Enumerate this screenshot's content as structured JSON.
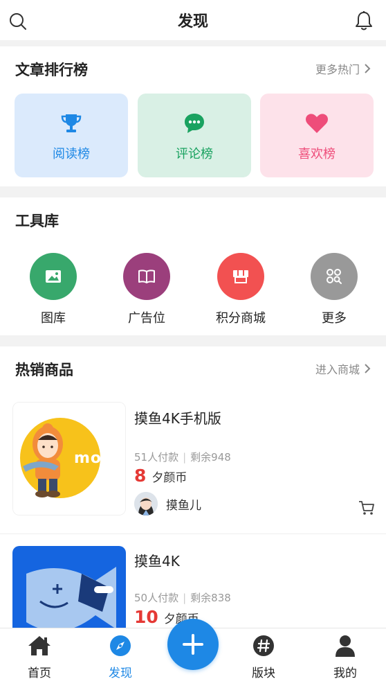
{
  "header": {
    "title": "发现"
  },
  "ranking": {
    "title": "文章排行榜",
    "more_label": "更多热门",
    "tiles": [
      {
        "label": "阅读榜",
        "icon": "trophy-icon",
        "bg": "#dbeafc",
        "color": "#1e88e5"
      },
      {
        "label": "评论榜",
        "icon": "chat-bubble-icon",
        "bg": "#d9f0e5",
        "color": "#1aa260"
      },
      {
        "label": "喜欢榜",
        "icon": "heart-icon",
        "bg": "#fde2ea",
        "color": "#ee4d7a"
      }
    ]
  },
  "tools": {
    "title": "工具库",
    "items": [
      {
        "label": "图库",
        "icon": "image-icon",
        "color": "#38a86c"
      },
      {
        "label": "广告位",
        "icon": "book-icon",
        "color": "#9b3f7c"
      },
      {
        "label": "积分商城",
        "icon": "shop-icon",
        "color": "#f25151"
      },
      {
        "label": "更多",
        "icon": "grid-search-icon",
        "color": "#999999"
      }
    ]
  },
  "products": {
    "title": "热销商品",
    "more_label": "进入商城",
    "items": [
      {
        "name": "摸鱼4K手机版",
        "paid": "51人付款",
        "remaining": "剩余948",
        "price": "8",
        "unit": "夕颜币",
        "seller": "摸鱼儿",
        "logo_text": "moyu"
      },
      {
        "name": "摸鱼4K",
        "paid": "50人付款",
        "remaining": "剩余838",
        "price": "10",
        "unit": "夕颜币"
      }
    ]
  },
  "tabbar": {
    "tabs": [
      {
        "label": "首页",
        "icon": "home-icon",
        "active": false
      },
      {
        "label": "发现",
        "icon": "compass-icon",
        "active": true
      },
      {
        "label": "版块",
        "icon": "hashtag-icon",
        "active": false
      },
      {
        "label": "我的",
        "icon": "user-icon",
        "active": false
      }
    ],
    "fab_icon": "plus-icon"
  },
  "colors": {
    "accent": "#1e88e5",
    "price": "#e53935"
  }
}
